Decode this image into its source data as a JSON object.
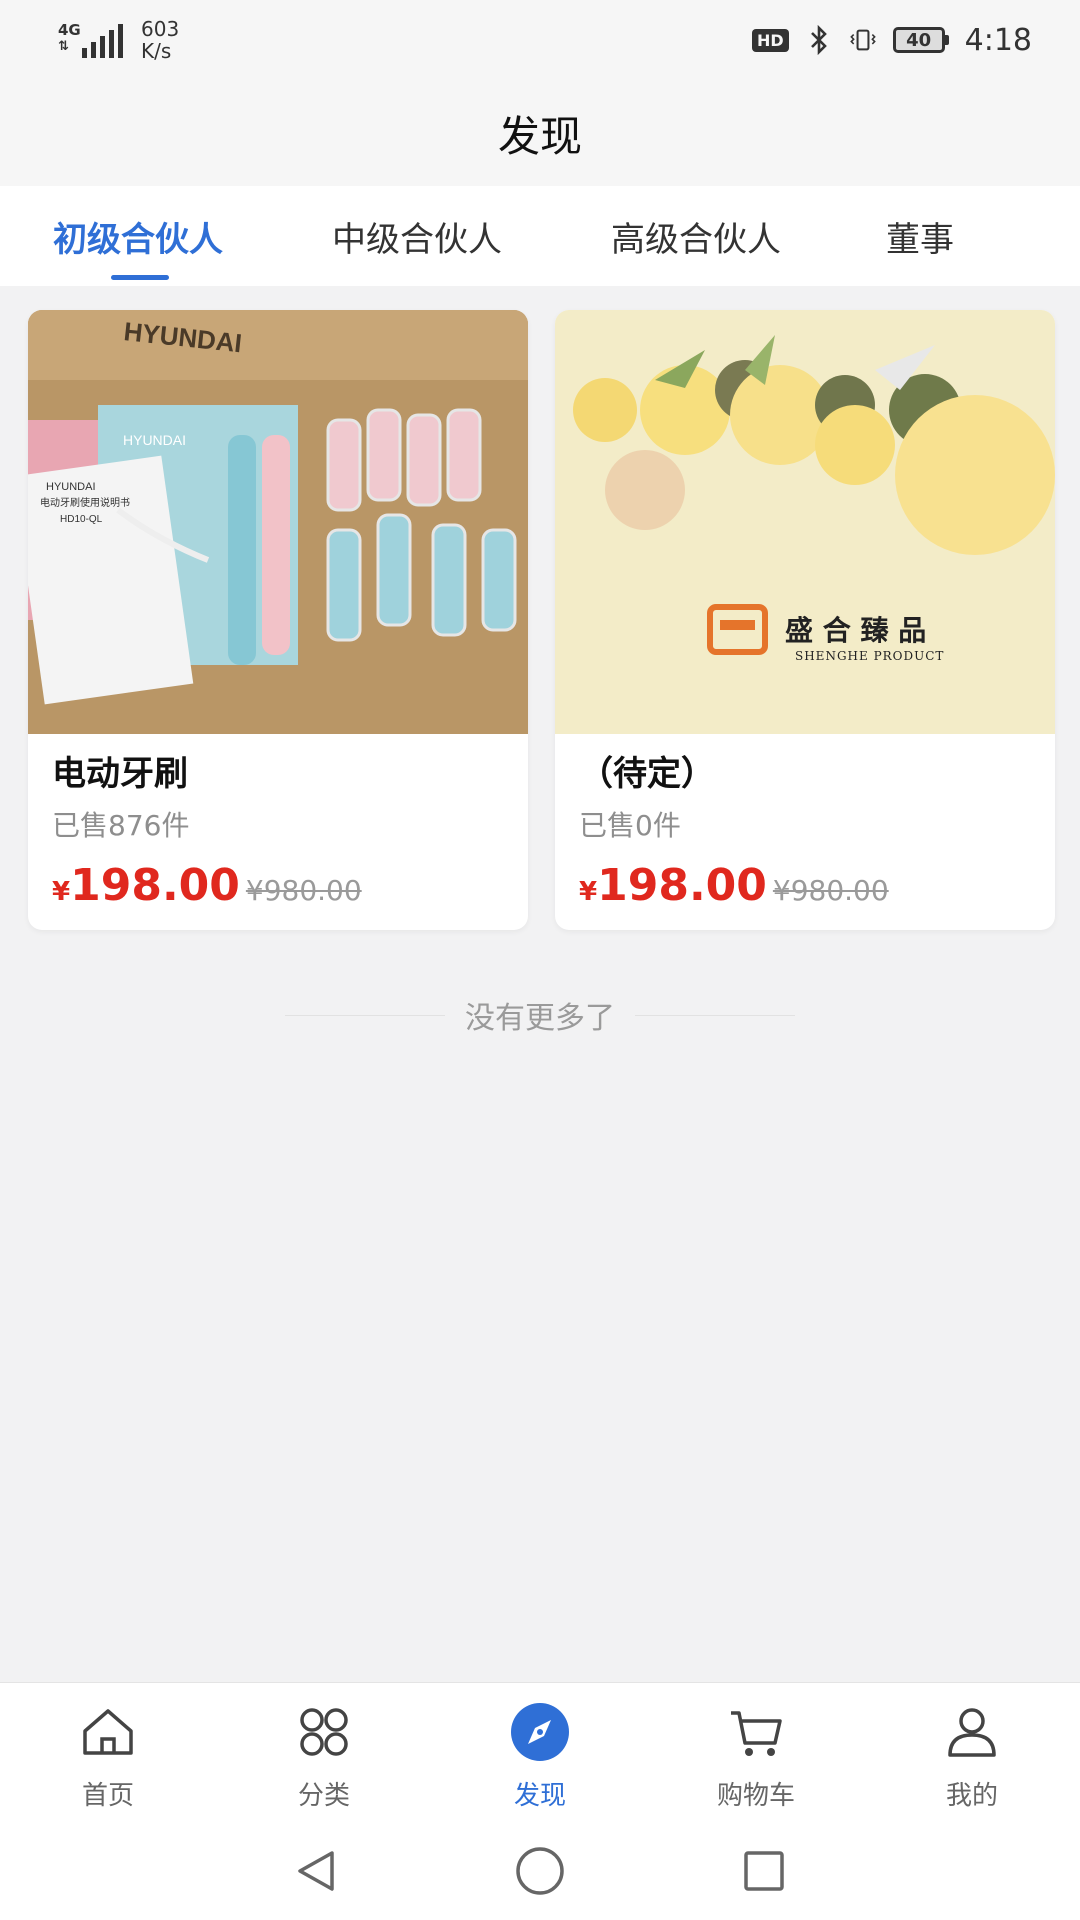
{
  "status_bar": {
    "network_type": "4G",
    "net_speed_value": "603",
    "net_speed_unit": "K/s",
    "hd_label": "HD",
    "battery_level": "40",
    "time": "4:18"
  },
  "header": {
    "title": "发现"
  },
  "tabs": [
    {
      "label": "初级合伙人",
      "active": true
    },
    {
      "label": "中级合伙人",
      "active": false
    },
    {
      "label": "高级合伙人",
      "active": false
    },
    {
      "label": "董事",
      "active": false
    }
  ],
  "products": [
    {
      "name": "电动牙刷",
      "sold": "已售876件",
      "currency": "¥",
      "price": "198.00",
      "original_price": "¥980.00",
      "image_text": [
        "HYUNDAI",
        "HYUNDAI",
        "HYUNDAI",
        "电动牙刷使用说明书",
        "HD10-QL"
      ]
    },
    {
      "name": "（待定）",
      "sold": "已售0件",
      "currency": "¥",
      "price": "198.00",
      "original_price": "¥980.00",
      "image_text": [
        "盛 合 臻 品",
        "SHENGHE PRODUCT"
      ]
    }
  ],
  "list_end_text": "没有更多了",
  "bottom_nav": [
    {
      "label": "首页",
      "icon": "home-icon",
      "active": false
    },
    {
      "label": "分类",
      "icon": "category-icon",
      "active": false
    },
    {
      "label": "发现",
      "icon": "discover-icon",
      "active": true
    },
    {
      "label": "购物车",
      "icon": "cart-icon",
      "active": false
    },
    {
      "label": "我的",
      "icon": "profile-icon",
      "active": false
    }
  ],
  "colors": {
    "accent": "#2f6fd6",
    "price_red": "#e0281e",
    "muted_text": "#8e8e8e",
    "page_bg": "#f2f2f3"
  }
}
